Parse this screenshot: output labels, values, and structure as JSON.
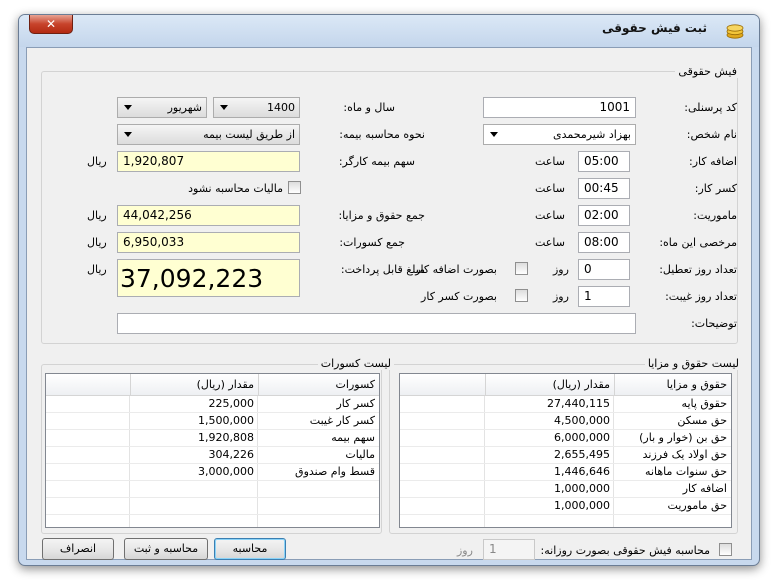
{
  "window": {
    "title": "ثبت فیش حقوقی",
    "close_glyph": "✕"
  },
  "form": {
    "group_title": "فیش حقوقی",
    "personnel_code": {
      "label": "کد پرسنلی:",
      "value": "1001"
    },
    "person_name": {
      "label": "نام شخص:",
      "value": "بهزاد شیرمحمدی"
    },
    "overtime": {
      "label": "اضافه کار:",
      "value": "05:00",
      "unit": "ساعت"
    },
    "undertime": {
      "label": "کسر کار:",
      "value": "00:45",
      "unit": "ساعت"
    },
    "mission": {
      "label": "ماموریت:",
      "value": "02:00",
      "unit": "ساعت"
    },
    "leave": {
      "label": "مرخصی این ماه:",
      "value": "08:00",
      "unit": "ساعت"
    },
    "holiday_days": {
      "label": "تعداد روز تعطیل:",
      "value": "0",
      "unit": "روز",
      "checkbox_label": "بصورت اضافه کار",
      "checked": false
    },
    "absence_days": {
      "label": "تعداد روز غیبت:",
      "value": "1",
      "unit": "روز",
      "checkbox_label": "بصورت کسر کار",
      "checked": false
    },
    "description": {
      "label": "توضیحات:",
      "value": ""
    },
    "year_month": {
      "label": "سال و ماه:",
      "year": "1400",
      "month": "شهریور"
    },
    "insurance_method": {
      "label": "نحوه محاسبه بیمه:",
      "value": "از طریق لیست بیمه"
    },
    "employee_insurance": {
      "label": "سهم بیمه کارگر:",
      "value": "1,920,807",
      "unit": "ریال"
    },
    "no_tax": {
      "label": "مالیات محاسبه نشود",
      "checked": false
    },
    "total_salary": {
      "label": "جمع حقوق و مزایا:",
      "value": "44,042,256",
      "unit": "ریال"
    },
    "total_deductions": {
      "label": "جمع کسورات:",
      "value": "6,950,033",
      "unit": "ریال"
    },
    "payable": {
      "label": "مبلغ قابل پرداخت:",
      "value": "37,092,223",
      "unit": "ریال"
    }
  },
  "salary_list": {
    "title": "لیست حقوق و مزایا",
    "columns": [
      "حقوق و مزایا",
      "مقدار (ریال)"
    ],
    "rows": [
      [
        "حقوق پایه",
        "27,440,115"
      ],
      [
        "حق مسکن",
        "4,500,000"
      ],
      [
        "حق بن (خوار و بار)",
        "6,000,000"
      ],
      [
        "حق اولاد یک فرزند",
        "2,655,495"
      ],
      [
        "حق سنوات ماهانه",
        "1,446,646"
      ],
      [
        "اضافه کار",
        "1,000,000"
      ],
      [
        "حق ماموریت",
        "1,000,000"
      ]
    ]
  },
  "deduction_list": {
    "title": "لیست کسورات",
    "columns": [
      "کسورات",
      "مقدار (ریال)"
    ],
    "rows": [
      [
        "کسر کار",
        "225,000"
      ],
      [
        "کسر کار غیبت",
        "1,500,000"
      ],
      [
        "سهم بیمه",
        "1,920,808"
      ],
      [
        "مالیات",
        "304,226"
      ],
      [
        "قسط وام صندوق",
        "3,000,000"
      ]
    ]
  },
  "daily": {
    "label": "محاسبه فیش حقوقی بصورت روزانه:",
    "checked": false,
    "value": "1",
    "unit": "روز"
  },
  "buttons": {
    "calculate": "محاسبه",
    "calculate_save": "محاسبه و ثبت",
    "cancel": "انصراف"
  }
}
